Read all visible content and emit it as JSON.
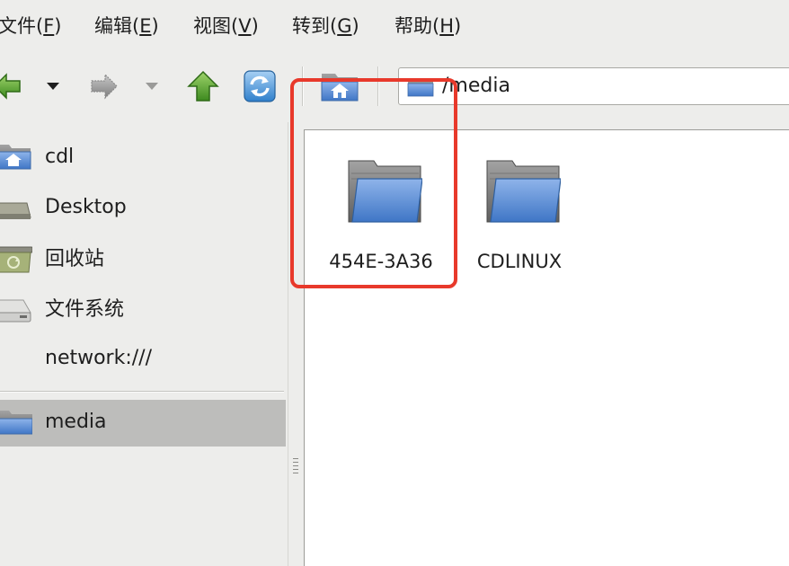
{
  "menubar": {
    "items": [
      {
        "label": "文件(",
        "accel": "F",
        "close": ")"
      },
      {
        "label": "编辑(",
        "accel": "E",
        "close": ")"
      },
      {
        "label": "视图(",
        "accel": "V",
        "close": ")"
      },
      {
        "label": "转到(",
        "accel": "G",
        "close": ")"
      },
      {
        "label": "帮助(",
        "accel": "H",
        "close": ")"
      }
    ]
  },
  "toolbar": {
    "buttons": [
      {
        "name": "back-icon"
      },
      {
        "name": "back-history-dropdown-icon"
      },
      {
        "name": "forward-icon"
      },
      {
        "name": "forward-history-dropdown-icon"
      },
      {
        "name": "up-icon"
      },
      {
        "name": "reload-icon"
      },
      {
        "name": "folder-icon"
      },
      {
        "name": "home-icon"
      }
    ]
  },
  "location": {
    "path": "/media",
    "icon": "folder-icon"
  },
  "sidebar": {
    "items": [
      {
        "label": "cdl",
        "icon": "home-folder-icon"
      },
      {
        "label": "Desktop",
        "icon": "desktop-icon"
      },
      {
        "label": "回收站",
        "icon": "trash-icon"
      },
      {
        "label": "文件系统",
        "icon": "harddisk-icon"
      },
      {
        "label": "network:///",
        "icon": ""
      },
      {
        "label": "media",
        "icon": "folder-icon",
        "selected": true
      }
    ]
  },
  "files": [
    {
      "name": "454E-3A36",
      "icon": "folder-icon"
    },
    {
      "name": "CDLINUX",
      "icon": "folder-icon"
    }
  ],
  "colors": {
    "highlight": "#e8392b",
    "folder_blue": "#5b8fd4",
    "selection": "#bdbdbb"
  }
}
